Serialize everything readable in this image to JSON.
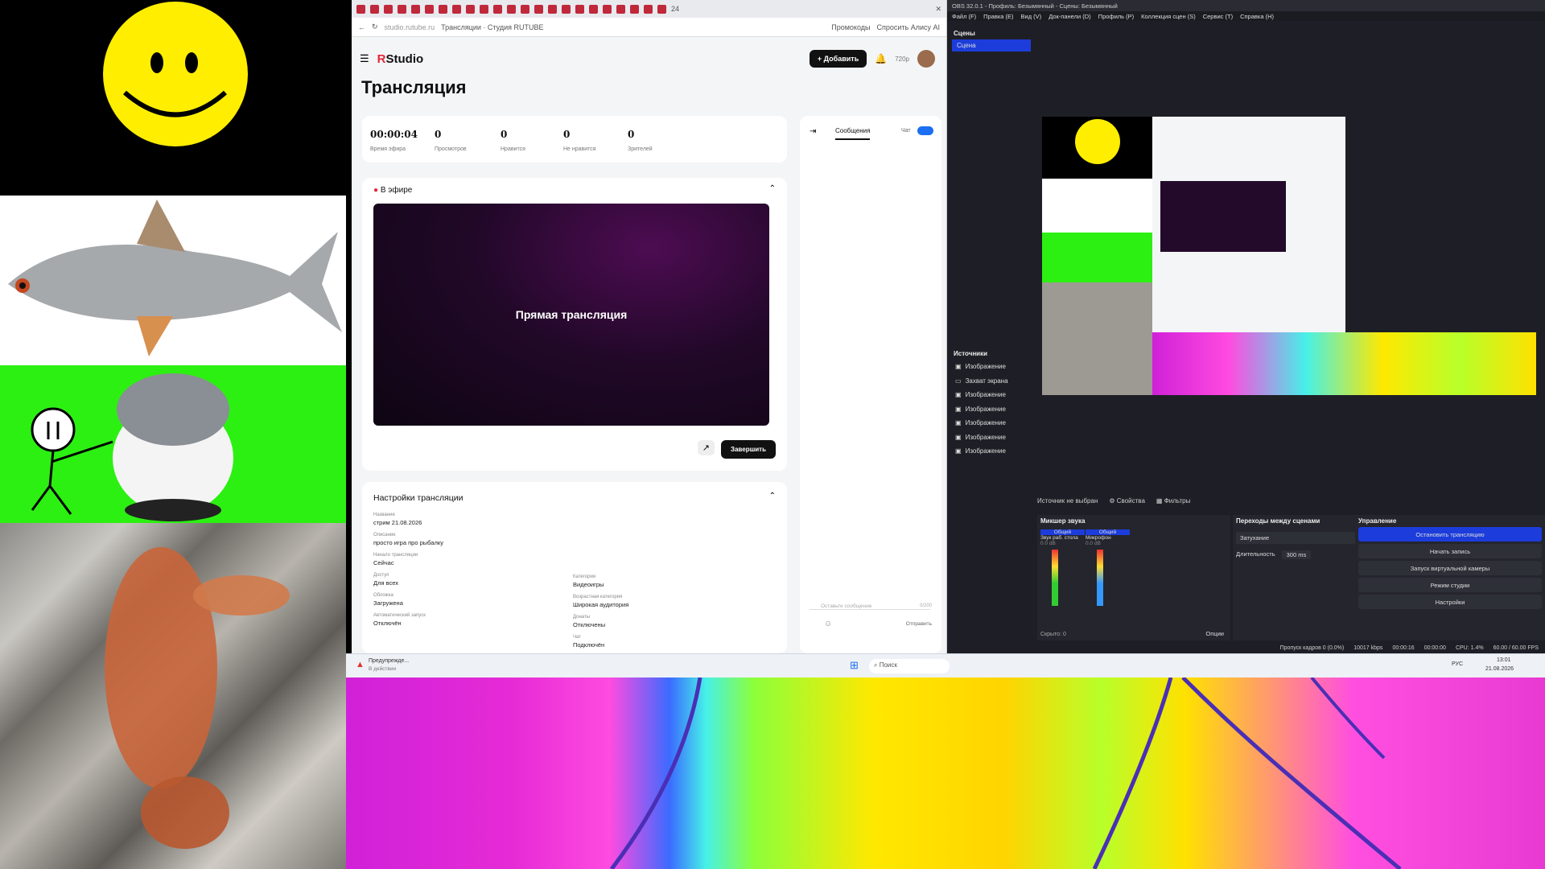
{
  "browser": {
    "address": "studio.rutube.ru",
    "page_title": "Трансляции · Студия RUTUBE",
    "bookmark_promo": "Промокоды",
    "bookmark_alice": "Спросить Алису AI",
    "tab_count": "24"
  },
  "studio": {
    "logo_prefix": "R",
    "logo_text": "Studio",
    "add_button": "Добавить",
    "quality": "720p",
    "heading": "Трансляция",
    "stats": [
      {
        "value": "00:00:04",
        "label": "Время эфира"
      },
      {
        "value": "0",
        "label": "Просмотров"
      },
      {
        "value": "0",
        "label": "Нравится"
      },
      {
        "value": "0",
        "label": "Не нравится"
      },
      {
        "value": "0",
        "label": "Зрителей"
      }
    ],
    "live_label": "В эфире",
    "player_text": "Прямая трансляция",
    "finish_button": "Завершить",
    "chat_tab": "Сообщения",
    "chat_toggle_label": "Чат",
    "chat_input_placeholder": "Оставьте сообщение",
    "chat_counter": "0/200",
    "chat_send": "Отправить",
    "settings_title": "Настройки трансляции",
    "settings_left": [
      {
        "label": "Название",
        "value": "стрим 21.08.2026"
      },
      {
        "label": "Описание",
        "value": "просто игра про рыбалку"
      },
      {
        "label": "Начало трансляции",
        "value": "Сейчас"
      },
      {
        "label": "Доступ",
        "value": "Для всех"
      },
      {
        "label": "Обложка",
        "value": "Загружена"
      },
      {
        "label": "Автоматический запуск",
        "value": "Отключён"
      }
    ],
    "settings_right": [
      {
        "label": "Категория",
        "value": "Видеоигры"
      },
      {
        "label": "Возрастная категория",
        "value": "Широкая аудитория"
      },
      {
        "label": "Донаты",
        "value": "Отключены"
      },
      {
        "label": "Чат",
        "value": "Подключён"
      }
    ]
  },
  "obs": {
    "title": "OBS 32.0.1 - Профиль: Безымянный - Сцены: Безымянный",
    "menu": [
      "Файл (F)",
      "Правка (E)",
      "Вид (V)",
      "Док-панели (D)",
      "Профиль (P)",
      "Коллекция сцен (S)",
      "Сервис (T)",
      "Справка (H)"
    ],
    "scenes_title": "Сцены",
    "scene_item": "Сцена",
    "sources_title": "Источники",
    "sources": [
      "Изображение",
      "Захват экрана",
      "Изображение",
      "Изображение",
      "Изображение",
      "Изображение",
      "Изображение"
    ],
    "no_source": "Источник не выбран",
    "properties": "Свойства",
    "filters": "Фильтры",
    "mixer_title": "Микшер звука",
    "mixer_channels": [
      {
        "tag": "Общий",
        "name": "Звук раб. стола",
        "db": "0.0 dB"
      },
      {
        "tag": "Общий",
        "name": "Микрофон",
        "db": "0.0 dB"
      }
    ],
    "hidden": "Скрыто: 0",
    "options": "Опции",
    "transitions_title": "Переходы между сценами",
    "transition": "Затухание",
    "duration_label": "Длительность",
    "duration_value": "300 ms",
    "controls_title": "Управление",
    "controls": [
      "Остановить трансляцию",
      "Начать запись",
      "Запуск виртуальной камеры",
      "Режим студии",
      "Настройки"
    ],
    "status": {
      "dropped": "Пропуск кадров 0 (0.0%)",
      "bitrate": "10017 kbps",
      "live_time": "00:00:16",
      "rec_time": "00:00:00",
      "cpu": "CPU: 1.4%",
      "fps": "60.00 / 60.00 FPS"
    }
  },
  "taskbar": {
    "warning_title": "Предупрежде...",
    "warning_sub": "В действии",
    "search": "Поиск",
    "lang": "РУС",
    "time": "13:01",
    "date": "21.08.2026"
  },
  "colors": {
    "accent": "#e3283a",
    "obs_blue": "#1c3ddb",
    "green_screen": "#2cf012"
  }
}
